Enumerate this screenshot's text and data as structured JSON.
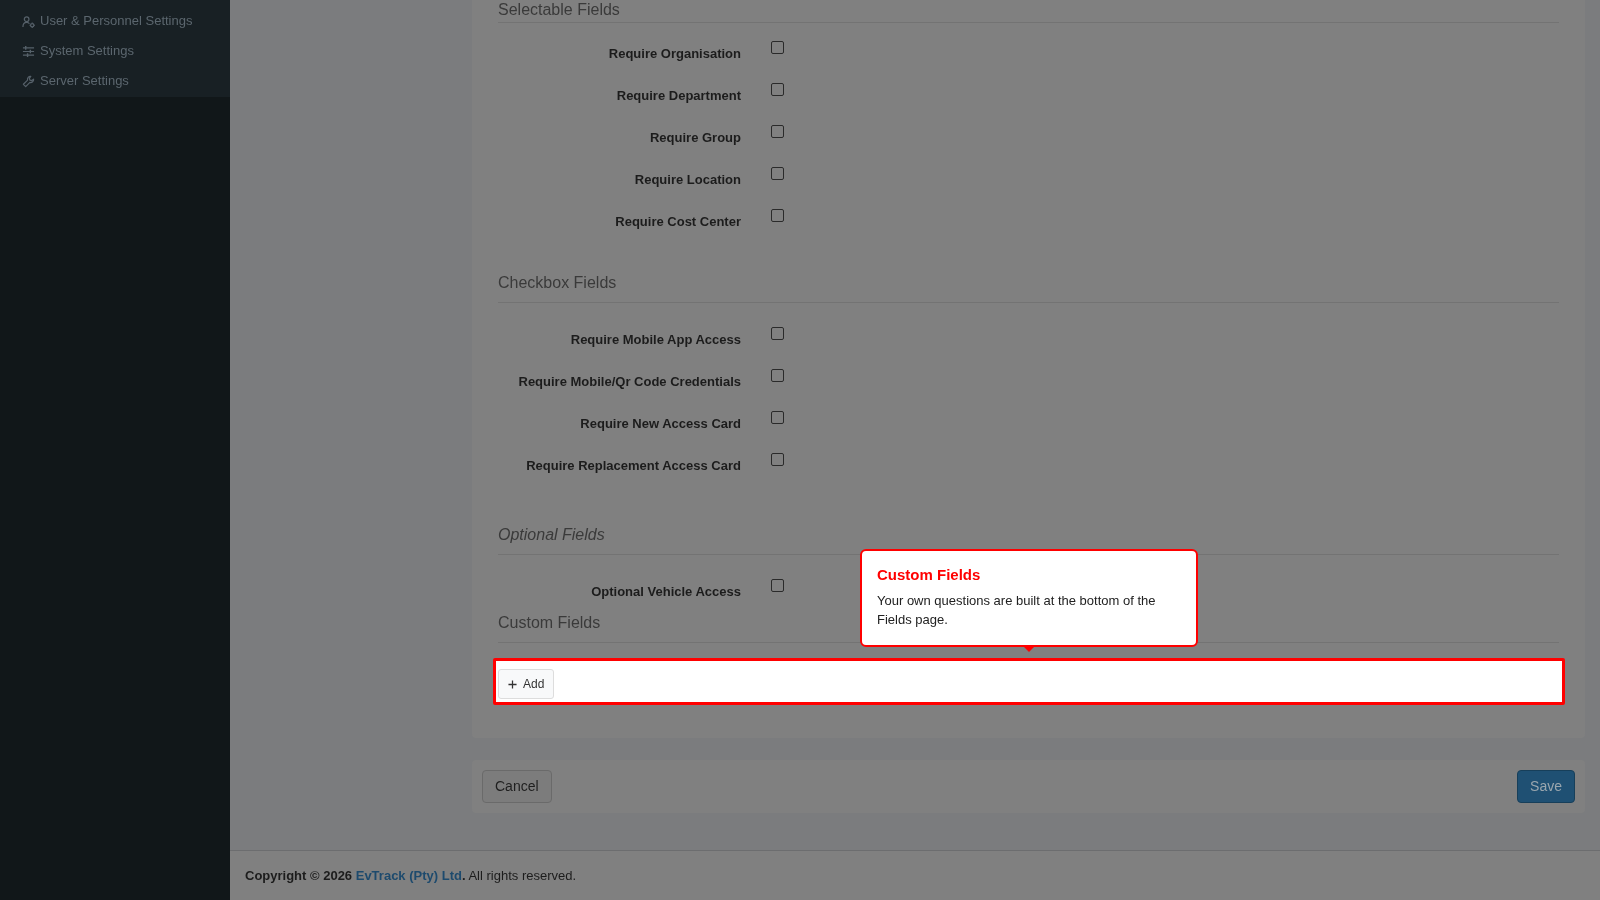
{
  "sidebar": {
    "items": [
      {
        "label": "User & Personnel Settings"
      },
      {
        "label": "System Settings"
      },
      {
        "label": "Server Settings"
      }
    ]
  },
  "sections": [
    {
      "title": "Selectable Fields",
      "italic": false,
      "kind": "checkboxes",
      "fields": [
        {
          "label": "Require Organisation",
          "checked": false
        },
        {
          "label": "Require Department",
          "checked": false
        },
        {
          "label": "Require Group",
          "checked": false
        },
        {
          "label": "Require Location",
          "checked": false
        },
        {
          "label": "Require Cost Center",
          "checked": false
        }
      ]
    },
    {
      "title": "Checkbox Fields",
      "italic": false,
      "kind": "checkboxes",
      "fields": [
        {
          "label": "Require Mobile App Access",
          "checked": false
        },
        {
          "label": "Require Mobile/Qr Code Credentials",
          "checked": false
        },
        {
          "label": "Require New Access Card",
          "checked": false
        },
        {
          "label": "Require Replacement Access Card",
          "checked": false
        }
      ]
    },
    {
      "title": "Optional Fields",
      "italic": true,
      "kind": "checkboxes",
      "fields": [
        {
          "label": "Optional Vehicle Access",
          "checked": false
        }
      ]
    },
    {
      "title": "Custom Fields",
      "italic": false,
      "kind": "custom",
      "add_button": "Add"
    }
  ],
  "tour_popover": {
    "title": "Custom Fields",
    "body": "Your own questions are built at the bottom of the Fields page."
  },
  "actions": {
    "cancel": "Cancel",
    "save": "Save"
  },
  "footer": {
    "copyright": "Copyright © 2026",
    "company_link": "EvTrack (Pty) Ltd",
    "link_suffix": ".",
    "rights": "All rights reserved."
  }
}
